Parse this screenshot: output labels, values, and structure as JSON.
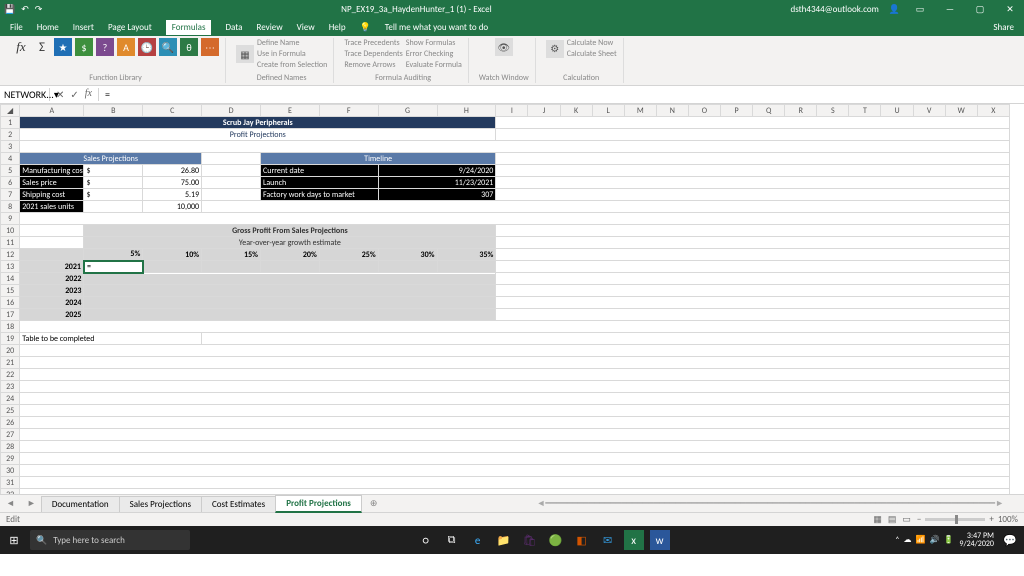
{
  "titlebar": {
    "doc": "NP_EX19_3a_HaydenHunter_1 (1) - Excel",
    "user": "dsth4344@outlook.com"
  },
  "menu": {
    "file": "File",
    "home": "Home",
    "insert": "Insert",
    "page": "Page Layout",
    "formulas": "Formulas",
    "data": "Data",
    "review": "Review",
    "view": "View",
    "help": "Help",
    "tell": "Tell me what you want to do",
    "share": "Share"
  },
  "ribbon": {
    "insertfn": "Insert Function",
    "autosum": "AutoSum",
    "recent": "Recently Used",
    "financial": "Financial",
    "logical": "Logical",
    "text": "Text",
    "datetime": "Date & Time",
    "lookup": "Lookup & Reference",
    "math": "Math & Trig",
    "more": "More Functions",
    "g1": "Function Library",
    "namemgr": "Name Manager",
    "defname": "Define Name",
    "usein": "Use in Formula",
    "createsel": "Create from Selection",
    "g2": "Defined Names",
    "trprec": "Trace Precedents",
    "trdep": "Trace Dependents",
    "remarr": "Remove Arrows",
    "showf": "Show Formulas",
    "errchk": "Error Checking",
    "evalf": "Evaluate Formula",
    "g3": "Formula Auditing",
    "watch": "Watch Window",
    "calcopt": "Calculation Options",
    "calcnow": "Calculate Now",
    "calcsheet": "Calculate Sheet",
    "g4": "Calculation"
  },
  "fx": {
    "cellref": "NETWORK...",
    "formula": "="
  },
  "cols": [
    "A",
    "B",
    "C",
    "D",
    "E",
    "F",
    "G",
    "H",
    "I",
    "J",
    "K",
    "L",
    "M",
    "N",
    "O",
    "P",
    "Q",
    "R",
    "S",
    "T",
    "U",
    "V",
    "W",
    "X"
  ],
  "sheet": {
    "title": "Scrub Jay Peripherals",
    "subtitle": "Profit Projections",
    "salesHead": "Sales Projections",
    "timelineHead": "Timeline",
    "mfg": "Manufacturing cost",
    "mfgCur": "$",
    "mfgVal": "26.80",
    "price": "Sales price",
    "priceCur": "$",
    "priceVal": "75.00",
    "ship": "Shipping cost",
    "shipCur": "$",
    "shipVal": "5.19",
    "units": "2021 sales units",
    "unitsVal": "10,000",
    "curDate": "Current date",
    "curDateVal": "9/24/2020",
    "launch": "Launch",
    "launchVal": "11/23/2021",
    "fwd": "Factory work days to market",
    "fwdVal": "307",
    "gp": "Gross Profit From Sales Projections",
    "yoy": "Year-over-year growth estimate",
    "p5": "5%",
    "p10": "10%",
    "p15": "15%",
    "p20": "20%",
    "p25": "25%",
    "p30": "30%",
    "p35": "35%",
    "y2021": "2021",
    "y2022": "2022",
    "y2023": "2023",
    "y2024": "2024",
    "y2025": "2025",
    "edit": "=",
    "tbc": "Table to be completed"
  },
  "tabs": {
    "t1": "Documentation",
    "t2": "Sales Projections",
    "t3": "Cost Estimates",
    "t4": "Profit Projections"
  },
  "status": {
    "mode": "Edit",
    "zoom": "100%"
  },
  "taskbar": {
    "search": "Type here to search",
    "time": "3:47 PM",
    "date": "9/24/2020"
  },
  "chart_data": {
    "type": "table",
    "title": "Gross Profit From Sales Projections — Year-over-year growth estimate",
    "columns": [
      "5%",
      "10%",
      "15%",
      "20%",
      "25%",
      "30%",
      "35%"
    ],
    "rows": [
      "2021",
      "2022",
      "2023",
      "2024",
      "2025"
    ],
    "values": null,
    "note": "Table to be completed",
    "inputs": {
      "manufacturing_cost": 26.8,
      "sales_price": 75.0,
      "shipping_cost": 5.19,
      "sales_units_2021": 10000,
      "current_date": "9/24/2020",
      "launch": "11/23/2021",
      "factory_work_days_to_market": 307
    }
  }
}
